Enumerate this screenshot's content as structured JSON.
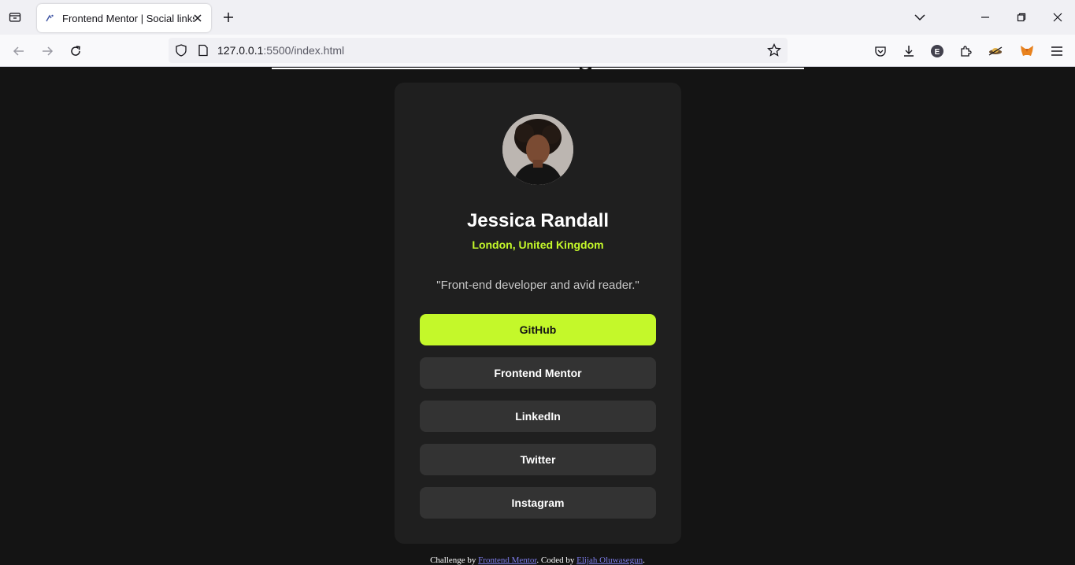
{
  "browser": {
    "tab_title": "Frontend Mentor | Social links profile",
    "url_host": "127.0.0.1",
    "url_rest": ":5500/index.html"
  },
  "profile": {
    "name": "Jessica Randall",
    "location": "London, United Kingdom",
    "bio": "\"Front-end developer and avid reader.\""
  },
  "links": [
    {
      "label": "GitHub"
    },
    {
      "label": "Frontend Mentor"
    },
    {
      "label": "LinkedIn"
    },
    {
      "label": "Twitter"
    },
    {
      "label": "Instagram"
    }
  ],
  "footer": {
    "prefix": "Challenge by ",
    "fm_link": "Frontend Mentor",
    "middle": ". Coded by ",
    "author_link": "Elijah Oluwasegun",
    "suffix": "."
  },
  "colors": {
    "accent": "#c4f82a",
    "card": "#1f1f1f",
    "button": "#333333",
    "background": "#141414"
  }
}
